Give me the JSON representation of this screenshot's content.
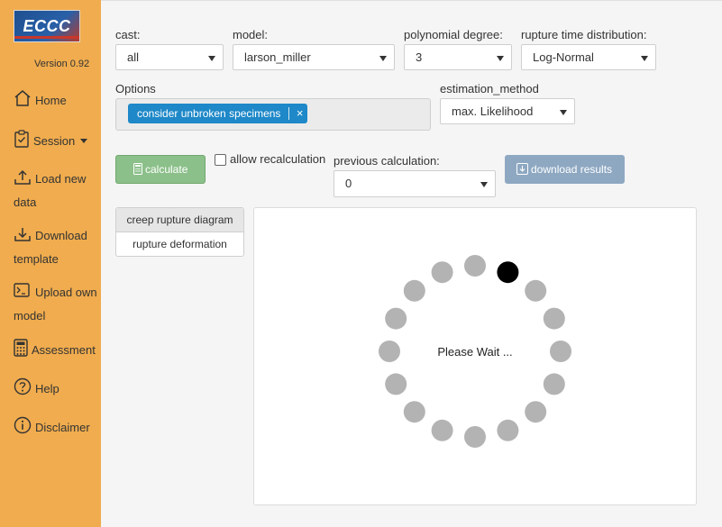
{
  "sidebar": {
    "logo_text": "ECCC",
    "version": "Version 0.92",
    "items": [
      {
        "label": "Home",
        "icon": "home-icon"
      },
      {
        "label": "Session",
        "icon": "clipboard-check-icon",
        "dropdown": true
      },
      {
        "label": "Load new",
        "label2": "data",
        "icon": "upload-icon"
      },
      {
        "label": "Download",
        "label2": "template",
        "icon": "download-icon"
      },
      {
        "label": "Upload own",
        "label2": "model",
        "icon": "terminal-icon"
      },
      {
        "label": "Assessment",
        "icon": "calculator-icon",
        "dropdown": true
      },
      {
        "label": "Help",
        "icon": "question-circle-icon"
      },
      {
        "label": "Disclaimer",
        "icon": "info-circle-icon"
      }
    ]
  },
  "form": {
    "cast": {
      "label": "cast:",
      "value": "all"
    },
    "model": {
      "label": "model:",
      "value": "larson_miller"
    },
    "polynomial_degree": {
      "label": "polynomial degree:",
      "value": "3"
    },
    "rupture_time_distribution": {
      "label": "rupture time distribution:",
      "value": "Log-Normal"
    },
    "options": {
      "label": "Options",
      "selected_tag": "consider unbroken specimens",
      "remove_glyph": "×"
    },
    "estimation_method": {
      "label": "estimation_method",
      "value": "max. Likelihood"
    }
  },
  "actions": {
    "calculate_label": "calculate",
    "allow_recalculation_label": "allow recalculation",
    "allow_recalculation_checked": false,
    "previous_calculation": {
      "label": "previous calculation:",
      "value": "0"
    },
    "download_results_label": "download results"
  },
  "tabs": [
    {
      "label": "creep rupture diagram",
      "active": true
    },
    {
      "label": "rupture deformation",
      "active": false
    }
  ],
  "loading": {
    "message": "Please Wait ...",
    "dot_count": 16,
    "active_dot_index": 1,
    "dot_color": "#b3b3b3",
    "active_dot_color": "#000000"
  },
  "colors": {
    "sidebar": "#f0ac4e",
    "tag": "#1e88c8",
    "calculate_button": "#8cc08a",
    "download_button": "#8ea8c2"
  }
}
